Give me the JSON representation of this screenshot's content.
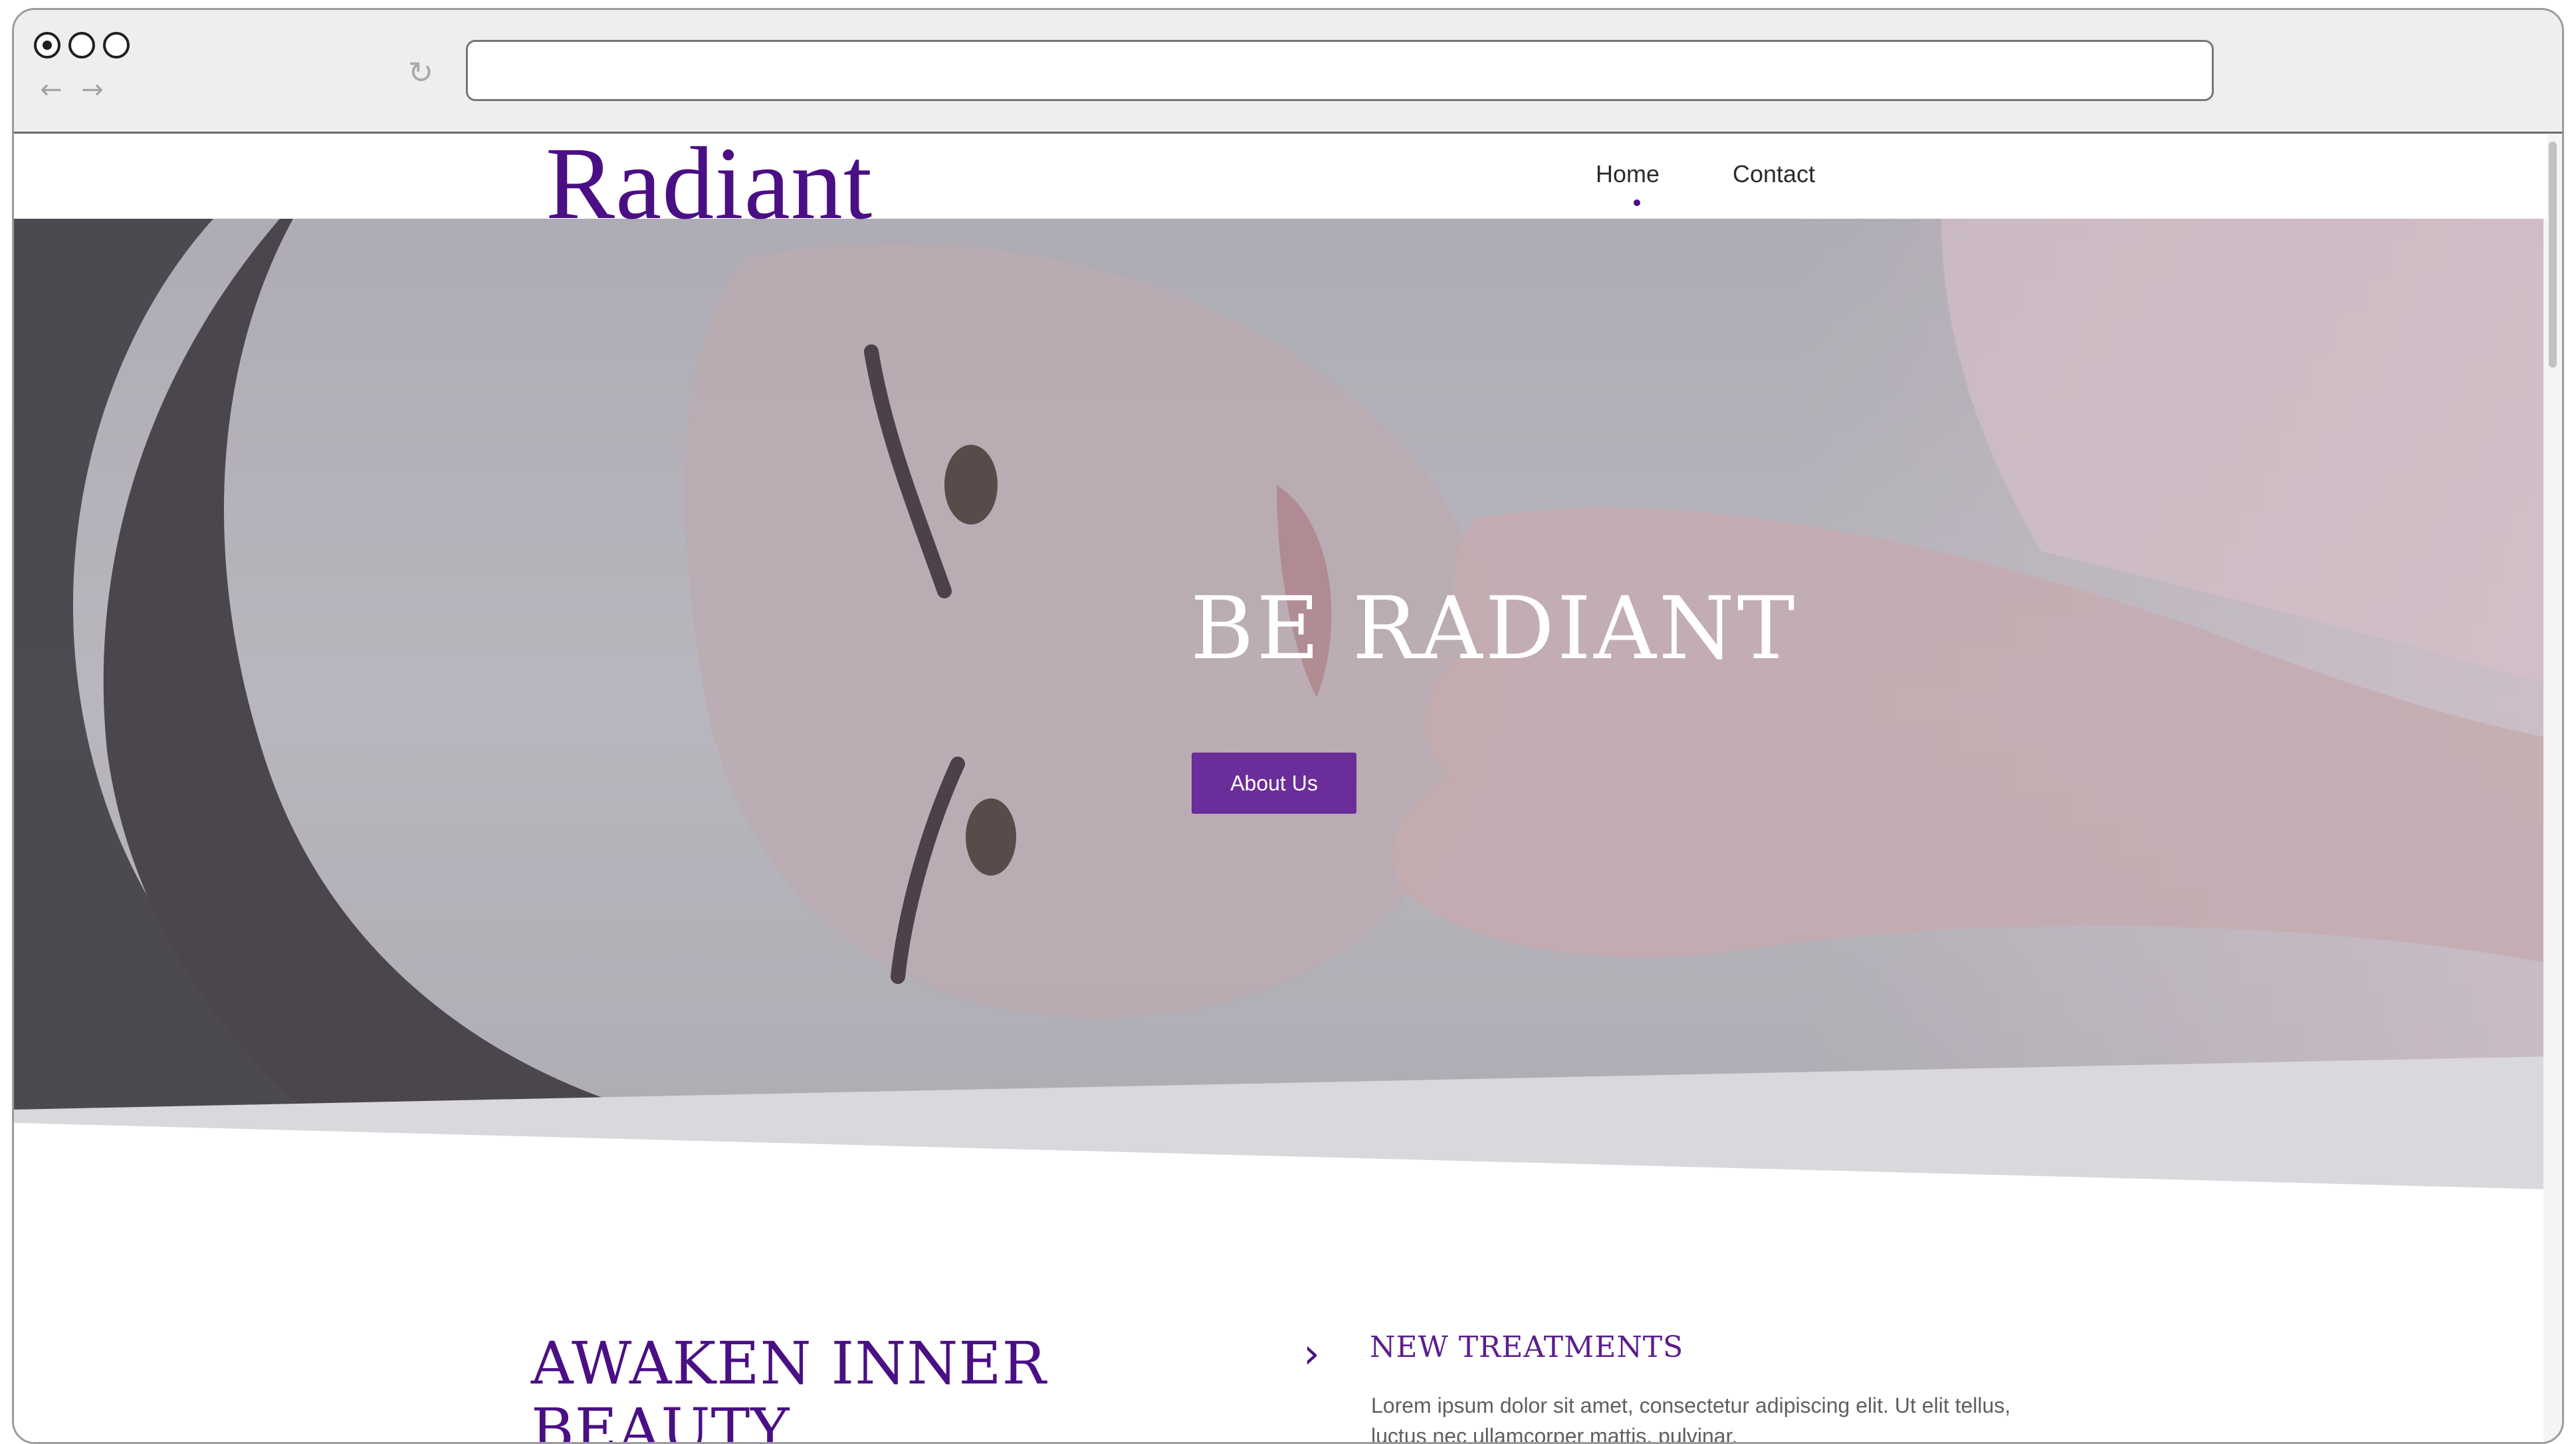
{
  "browser": {
    "url": "",
    "controls": {
      "back_icon": "arrow-left-icon",
      "forward_icon": "arrow-right-icon",
      "reload_icon": "reload-icon"
    }
  },
  "site": {
    "logo": "Radiant",
    "nav": [
      {
        "label": "Home",
        "active": true
      },
      {
        "label": "Contact",
        "active": false
      }
    ]
  },
  "hero": {
    "title": "BE RADIANT",
    "button_label": "About Us"
  },
  "content": {
    "heading_line1": "AWAKEN INNER",
    "heading_line2": "BEAUTY",
    "sub_heading": "NEW TREATMENTS",
    "sub_text": "Lorem ipsum dolor sit amet, consectetur adipiscing elit. Ut elit tellus, luctus nec ullamcorper mattis, pulvinar."
  },
  "colors": {
    "brand": "#4a0f84",
    "button": "#6b2d99"
  }
}
